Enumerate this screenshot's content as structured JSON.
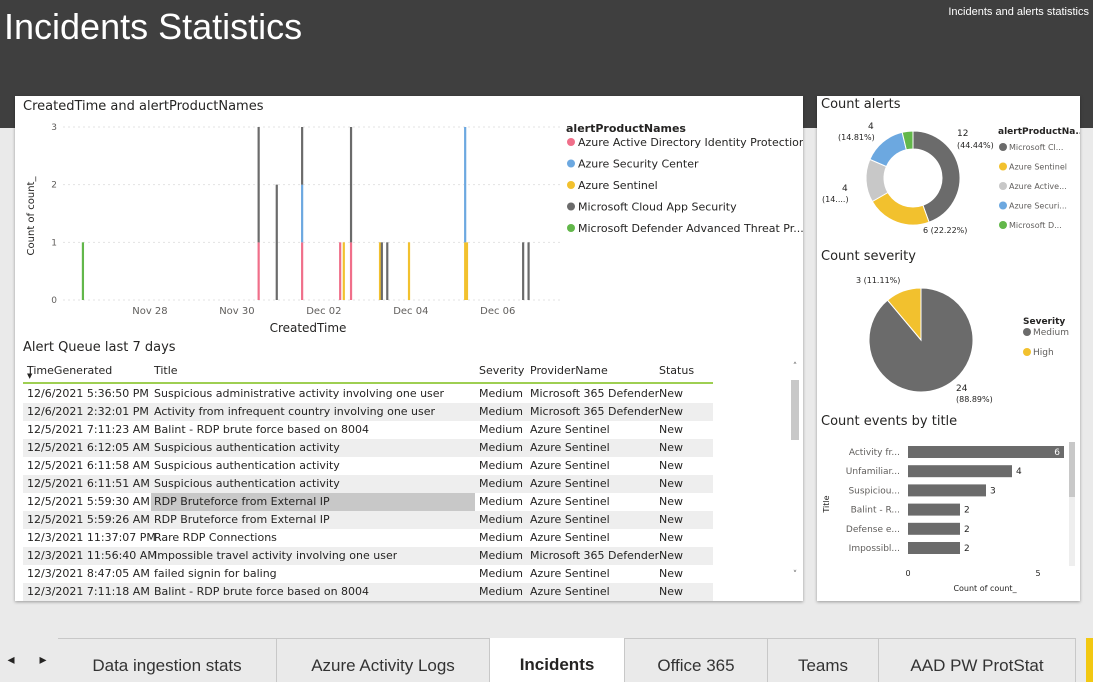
{
  "header": {
    "title": "Incidents Statistics",
    "subtitle": "Incidents and alerts statistics"
  },
  "colors": {
    "header_bg": "#3f3f3f",
    "aad": "#f06f8a",
    "asc": "#6ca8e0",
    "sentinel": "#f2c12e",
    "mcas": "#6b6b6b",
    "mdatp": "#62b74a",
    "light_gray": "#c8c8c8",
    "accent_green": "#9ecf52",
    "tab_accent": "#f2c811"
  },
  "line_chart": {
    "title": "CreatedTime and alertProductNames",
    "legend_title": "alertProductNames",
    "legend": [
      "Azure Active Directory Identity Protection",
      "Azure Security Center",
      "Azure Sentinel",
      "Microsoft Cloud App Security",
      "Microsoft Defender Advanced Threat Pr..."
    ]
  },
  "alert_queue": {
    "title": "Alert Queue last 7 days",
    "columns": [
      "TimeGenerated",
      "Title",
      "Severity",
      "ProviderName",
      "Status"
    ],
    "rows": [
      [
        "12/6/2021 5:36:50 PM",
        "Suspicious administrative activity involving one user",
        "Medium",
        "Microsoft 365 Defender",
        "New"
      ],
      [
        "12/6/2021 2:32:01 PM",
        "Activity from infrequent country involving one user",
        "Medium",
        "Microsoft 365 Defender",
        "New"
      ],
      [
        "12/5/2021 7:11:23 AM",
        "Balint - RDP brute force based on 8004",
        "Medium",
        "Azure Sentinel",
        "New"
      ],
      [
        "12/5/2021 6:12:05 AM",
        "Suspicious authentication activity",
        "Medium",
        "Azure Sentinel",
        "New"
      ],
      [
        "12/5/2021 6:11:58 AM",
        "Suspicious authentication activity",
        "Medium",
        "Azure Sentinel",
        "New"
      ],
      [
        "12/5/2021 6:11:51 AM",
        "Suspicious authentication activity",
        "Medium",
        "Azure Sentinel",
        "New"
      ],
      [
        "12/5/2021 5:59:30 AM",
        "RDP Bruteforce from External IP",
        "Medium",
        "Azure Sentinel",
        "New"
      ],
      [
        "12/5/2021 5:59:26 AM",
        "RDP Bruteforce from External IP",
        "Medium",
        "Azure Sentinel",
        "New"
      ],
      [
        "12/3/2021 11:37:07 PM",
        "Rare RDP Connections",
        "Medium",
        "Azure Sentinel",
        "New"
      ],
      [
        "12/3/2021 11:56:40 AM",
        "Impossible travel activity involving one user",
        "Medium",
        "Microsoft 365 Defender",
        "New"
      ],
      [
        "12/3/2021 8:47:05 AM",
        "failed signin for baling",
        "Medium",
        "Azure Sentinel",
        "New"
      ],
      [
        "12/3/2021 7:11:18 AM",
        "Balint - RDP brute force based on 8004",
        "Medium",
        "Azure Sentinel",
        "New"
      ]
    ]
  },
  "count_alerts": {
    "title": "Count alerts",
    "legend_title": "alertProductNa...",
    "legend": [
      "Microsoft Cl...",
      "Azure Sentinel",
      "Azure Active...",
      "Azure Securi...",
      "Microsoft D..."
    ],
    "labels": {
      "mcas_count": "12",
      "mcas_pct": "(44.44%)",
      "asc_count": "4",
      "asc_pct": "(14.81%)",
      "aad_count": "4",
      "aad_pct": "(14....)",
      "sentinel_label": "6 (22.22%)"
    }
  },
  "count_severity": {
    "title": "Count severity",
    "legend_title": "Severity",
    "legend": [
      "Medium",
      "High"
    ],
    "labels": {
      "high": "3 (11.11%)",
      "medium_count": "24",
      "medium_pct": "(88.89%)"
    }
  },
  "count_events": {
    "title": "Count events by title",
    "ylabel": "Title",
    "xlabel": "Count of count_",
    "xticks": [
      "0",
      "5"
    ]
  },
  "tabs": {
    "items": [
      "Data ingestion stats",
      "Azure Activity Logs",
      "Incidents",
      "Office 365",
      "Teams",
      "AAD PW ProtStat"
    ],
    "active": "Incidents"
  },
  "chart_data": [
    {
      "type": "bar",
      "title": "CreatedTime and alertProductNames",
      "xlabel": "CreatedTime",
      "ylabel": "Count of count_",
      "ylim": [
        0,
        3
      ],
      "yticks": [
        "0",
        "1",
        "2",
        "3"
      ],
      "xticks": [
        "Nov 28",
        "Nov 30",
        "Dec 02",
        "Dec 04",
        "Dec 06"
      ],
      "legend_title": "alertProductNames",
      "legend_position": "right",
      "grid": true,
      "stacked": true,
      "bars": [
        {
          "x": "2021-11-26T11:00",
          "segments": {
            "Microsoft Defender Advanced Threat Pr...": 1
          }
        },
        {
          "x": "2021-11-30T12:00",
          "segments": {
            "Azure Active Directory Identity Protection": 1,
            "Microsoft Cloud App Security": 2
          }
        },
        {
          "x": "2021-11-30T22:00",
          "segments": {
            "Microsoft Cloud App Security": 2
          }
        },
        {
          "x": "2021-12-01T12:00",
          "segments": {
            "Azure Active Directory Identity Protection": 1,
            "Azure Security Center": 1,
            "Microsoft Cloud App Security": 1
          }
        },
        {
          "x": "2021-12-02T09:00",
          "segments": {
            "Azure Active Directory Identity Protection": 1
          }
        },
        {
          "x": "2021-12-02T11:00",
          "segments": {
            "Azure Sentinel": 1
          }
        },
        {
          "x": "2021-12-02T15:00",
          "segments": {
            "Azure Active Directory Identity Protection": 1,
            "Microsoft Cloud App Security": 2
          }
        },
        {
          "x": "2021-12-03T07:00",
          "segments": {
            "Azure Sentinel": 1
          }
        },
        {
          "x": "2021-12-03T08:00",
          "segments": {
            "Microsoft Cloud App Security": 1
          }
        },
        {
          "x": "2021-12-03T11:00",
          "segments": {
            "Microsoft Cloud App Security": 1
          }
        },
        {
          "x": "2021-12-03T23:00",
          "segments": {
            "Azure Sentinel": 1
          }
        },
        {
          "x": "2021-12-05T06:00",
          "segments": {
            "Azure Sentinel": 1,
            "Azure Security Center": 2
          }
        },
        {
          "x": "2021-12-05T07:00",
          "segments": {
            "Azure Sentinel": 1
          }
        },
        {
          "x": "2021-12-06T14:00",
          "segments": {
            "Microsoft Cloud App Security": 1
          }
        },
        {
          "x": "2021-12-06T17:00",
          "segments": {
            "Microsoft Cloud App Security": 1
          }
        }
      ]
    },
    {
      "type": "pie",
      "title": "Count alerts",
      "donut": true,
      "legend_title": "alertProductNa...",
      "legend_position": "right",
      "slices": [
        {
          "name": "Microsoft Cl...",
          "value": 12
        },
        {
          "name": "Azure Sentinel",
          "value": 6
        },
        {
          "name": "Azure Active...",
          "value": 4
        },
        {
          "name": "Azure Securi...",
          "value": 4
        },
        {
          "name": "Microsoft D...",
          "value": 1
        }
      ]
    },
    {
      "type": "pie",
      "title": "Count severity",
      "legend_title": "Severity",
      "legend_position": "right",
      "slices": [
        {
          "name": "Medium",
          "value": 24
        },
        {
          "name": "High",
          "value": 3
        }
      ]
    },
    {
      "type": "bar",
      "orientation": "horizontal",
      "title": "Count events by title",
      "ylabel": "Title",
      "xlabel": "Count of count_",
      "xlim": [
        0,
        6
      ],
      "categories": [
        "Activity fr...",
        "Unfamiliar...",
        "Suspiciou...",
        "Balint - R...",
        "Defense e...",
        "Impossibl..."
      ],
      "values": [
        6,
        4,
        3,
        2,
        2,
        2
      ]
    }
  ]
}
